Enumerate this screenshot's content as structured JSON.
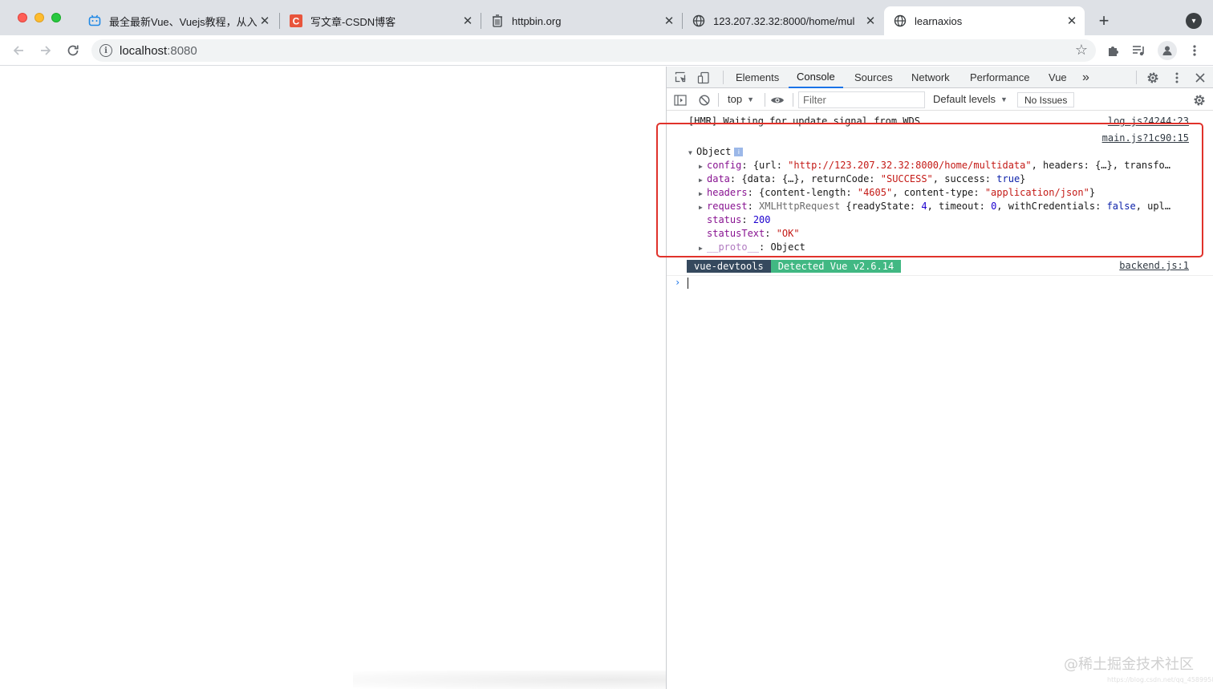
{
  "browser": {
    "tabs": [
      {
        "title": "最全最新Vue、Vuejs教程，从入门",
        "favicon": "bilibili-icon"
      },
      {
        "title": "写文章-CSDN博客",
        "favicon": "csdn-icon"
      },
      {
        "title": "httpbin.org",
        "favicon": "httpbin-icon"
      },
      {
        "title": "123.207.32.32:8000/home/mul",
        "favicon": "globe-icon"
      },
      {
        "title": "learnaxios",
        "favicon": "globe-icon",
        "active": true
      }
    ],
    "address": {
      "host": "localhost",
      "port": ":8080"
    }
  },
  "devtools": {
    "tabs": [
      "Elements",
      "Console",
      "Sources",
      "Network",
      "Performance",
      "Vue"
    ],
    "active_tab": "Console",
    "more": "»",
    "console_bar": {
      "context": "top",
      "filter_placeholder": "Filter",
      "levels": "Default levels",
      "issues": "No Issues"
    },
    "messages": {
      "hmr": {
        "text": "[HMR] Waiting for update signal from WDS...",
        "source": "log.js?4244:23"
      },
      "object_log": {
        "source": "main.js?1c90:15",
        "label": "Object",
        "info_badge": "i",
        "rows": {
          "config": {
            "key": "config",
            "p1": "{url: ",
            "url": "\"http://123.207.32.32:8000/home/multidata\"",
            "p2": ", headers: {…}, transfo…"
          },
          "data": {
            "key": "data",
            "p1": "{data: {…}, returnCode: ",
            "code": "\"SUCCESS\"",
            "p2": ", success: ",
            "success": "true",
            "p3": "}"
          },
          "headers": {
            "key": "headers",
            "p1": "{content-length: ",
            "len": "\"4605\"",
            "p2": ", content-type: ",
            "type": "\"application/json\"",
            "p3": "}"
          },
          "request": {
            "key": "request",
            "cls": "XMLHttpRequest",
            "p1": " {readyState: ",
            "ready": "4",
            "p2": ", timeout: ",
            "timeout": "0",
            "p3": ", withCredentials: ",
            "wc": "false",
            "p4": ", upl…"
          },
          "status": {
            "key": "status",
            "value": "200"
          },
          "statusText": {
            "key": "statusText",
            "value": "\"OK\""
          },
          "proto": {
            "key": "__proto__",
            "value": "Object"
          }
        }
      },
      "vue": {
        "tag": "vue-devtools",
        "text": "Detected Vue v2.6.14",
        "source": "backend.js:1"
      }
    },
    "prompt": "›"
  },
  "watermark": {
    "text": "@稀土掘金技术社区",
    "small": "https://blog.csdn.net/qq_45899588"
  },
  "colors": {
    "highlight_box": "#e0322b",
    "vue_dark": "#35495e",
    "vue_green": "#41b883"
  }
}
